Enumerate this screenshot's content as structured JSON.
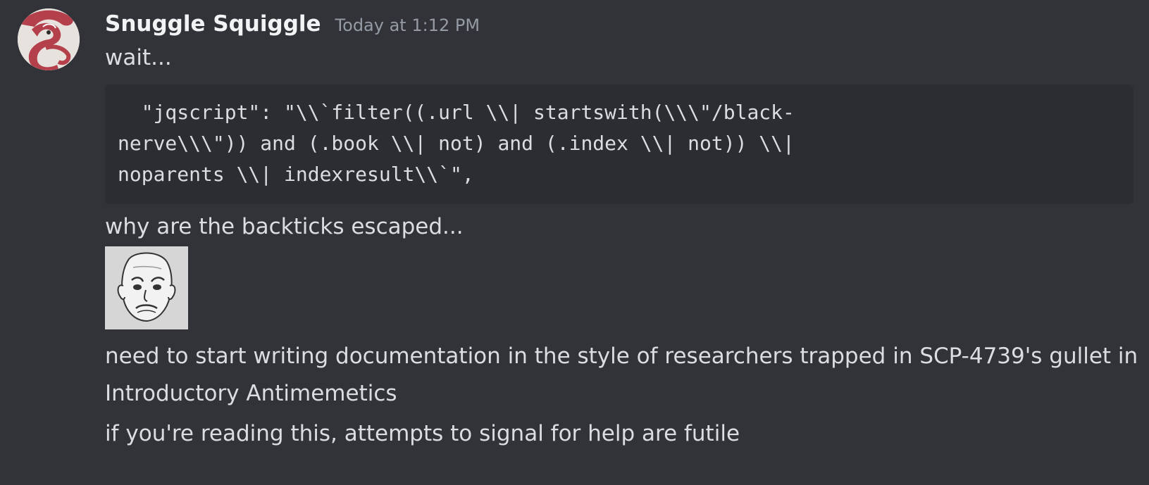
{
  "message": {
    "author": "Snuggle Squiggle",
    "timestamp": "Today at 1:12 PM",
    "lines": {
      "first": "wait...",
      "code": "  \"jqscript\": \"\\\\`filter((.url \\\\| startswith(\\\\\\\"/black-\nnerve\\\\\\\")) and (.book \\\\| not) and (.index \\\\| not)) \\\\|\nnoparents \\\\| indexresult\\\\`\",",
      "second": "why are the backticks escaped...",
      "third": "need to start writing documentation in the style of researchers trapped in SCP-4739's gullet in Introductory Antimemetics",
      "fourth": "if you're reading this, attempts to signal for help are futile"
    },
    "avatar_icon": "snake-avatar-icon",
    "sticker_icon": "worried-face-sticker"
  },
  "colors": {
    "background": "#313338",
    "codeblock": "#2b2d31",
    "username": "#f2f3f5",
    "text": "#dbdee1",
    "timestamp": "#949ba4"
  }
}
